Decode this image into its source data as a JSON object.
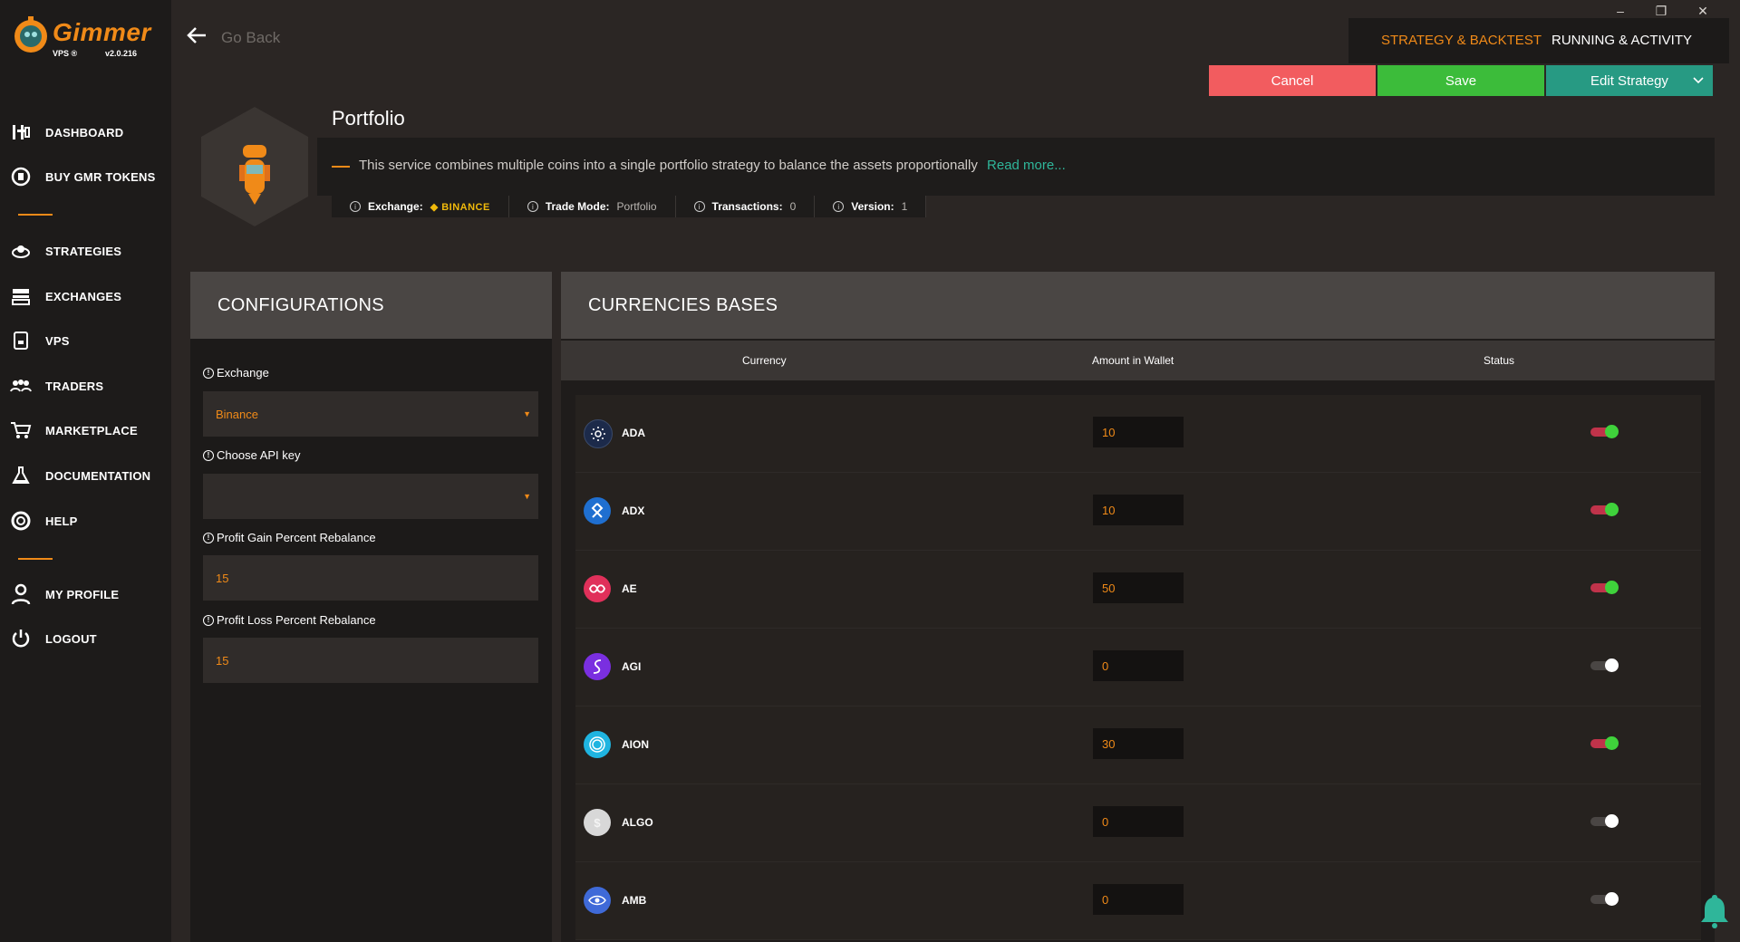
{
  "app": {
    "logo_text": "Gimmer",
    "logo_sub": "VPS ®",
    "version": "v2.0.216"
  },
  "sidebar": {
    "items": [
      {
        "label": "DASHBOARD",
        "icon": "dashboard-icon"
      },
      {
        "label": "BUY GMR TOKENS",
        "icon": "token-icon"
      },
      {
        "label": "STRATEGIES",
        "icon": "strategies-icon"
      },
      {
        "label": "EXCHANGES",
        "icon": "exchanges-icon"
      },
      {
        "label": "VPS",
        "icon": "vps-icon"
      },
      {
        "label": "TRADERS",
        "icon": "traders-icon"
      },
      {
        "label": "MARKETPLACE",
        "icon": "cart-icon"
      },
      {
        "label": "DOCUMENTATION",
        "icon": "flask-icon"
      },
      {
        "label": "HELP",
        "icon": "lifebuoy-icon"
      },
      {
        "label": "MY PROFILE",
        "icon": "user-icon"
      },
      {
        "label": "LOGOUT",
        "icon": "power-icon"
      }
    ]
  },
  "topbar": {
    "go_back": "Go Back",
    "tabs": {
      "strategy": "STRATEGY & BACKTEST",
      "running": "RUNNING & ACTIVITY"
    },
    "buttons": {
      "cancel": "Cancel",
      "save": "Save",
      "edit": "Edit Strategy"
    },
    "window_controls": {
      "minimize": "–",
      "restore": "❐",
      "close": "✕"
    }
  },
  "header": {
    "title": "Portfolio",
    "description": "This service combines multiple coins into a single portfolio strategy to balance the assets proportionally",
    "read_more": "Read more...",
    "info": {
      "exchange_label": "Exchange:",
      "exchange_value": "BINANCE",
      "trade_mode_label": "Trade Mode:",
      "trade_mode_value": "Portfolio",
      "transactions_label": "Transactions:",
      "transactions_value": "0",
      "version_label": "Version:",
      "version_value": "1"
    }
  },
  "config": {
    "title": "CONFIGURATIONS",
    "fields": [
      {
        "label": "Exchange",
        "value": "Binance",
        "type": "select"
      },
      {
        "label": "Choose API key",
        "value": "",
        "type": "select"
      },
      {
        "label": "Profit Gain Percent Rebalance",
        "value": "15",
        "type": "input"
      },
      {
        "label": "Profit Loss Percent Rebalance",
        "value": "15",
        "type": "input"
      }
    ]
  },
  "currencies": {
    "title": "CURRENCIES BASES",
    "columns": {
      "currency": "Currency",
      "amount": "Amount in Wallet",
      "status": "Status"
    },
    "rows": [
      {
        "symbol": "ADA",
        "amount": "10",
        "enabled": true,
        "color": "#1c2a4a"
      },
      {
        "symbol": "ADX",
        "amount": "10",
        "enabled": true,
        "color": "#1f6fd0"
      },
      {
        "symbol": "AE",
        "amount": "50",
        "enabled": true,
        "color": "#e0305a"
      },
      {
        "symbol": "AGI",
        "amount": "0",
        "enabled": false,
        "color": "#7a2fe0"
      },
      {
        "symbol": "AION",
        "amount": "30",
        "enabled": true,
        "color": "#1fb4e0"
      },
      {
        "symbol": "ALGO",
        "amount": "0",
        "enabled": false,
        "color": "#c8c8c8"
      },
      {
        "symbol": "AMB",
        "amount": "0",
        "enabled": false,
        "color": "#3f6ad8"
      }
    ]
  },
  "colors": {
    "accent": "#f08a18",
    "cancel": "#f25c5f",
    "save": "#3cbc3a",
    "edit": "#279a83",
    "link": "#2fb69a"
  }
}
